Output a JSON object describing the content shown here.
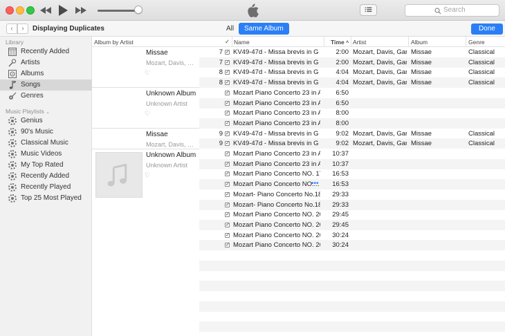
{
  "toolbar": {
    "search_placeholder": "Search",
    "volume_level": 0.92
  },
  "subbar": {
    "title": "Displaying Duplicates",
    "segment_all": "All",
    "segment_same_album": "Same Album",
    "done_label": "Done"
  },
  "sidebar": {
    "library_header": "Library",
    "library_items": [
      {
        "label": "Recently Added",
        "icon": "calendar-grid-icon"
      },
      {
        "label": "Artists",
        "icon": "microphone-icon"
      },
      {
        "label": "Albums",
        "icon": "album-icon"
      },
      {
        "label": "Songs",
        "icon": "music-note-icon",
        "selected": true
      },
      {
        "label": "Genres",
        "icon": "guitar-icon"
      }
    ],
    "playlists_header": "Music Playlists",
    "playlist_items": [
      {
        "label": "Genius"
      },
      {
        "label": "90's Music"
      },
      {
        "label": "Classical Music"
      },
      {
        "label": "Music Videos"
      },
      {
        "label": "My Top Rated"
      },
      {
        "label": "Recently Added"
      },
      {
        "label": "Recently Played"
      },
      {
        "label": "Top 25 Most Played"
      }
    ]
  },
  "columns": {
    "album_by_artist": "Album by Artist",
    "check": "✓",
    "name": "Name",
    "time": "Time",
    "artist": "Artist",
    "album": "Album",
    "genre": "Genre"
  },
  "albums": [
    {
      "name": "Missae",
      "artist": "Mozart, Davis, Gar..."
    },
    {
      "name": "Unknown Album",
      "artist": "Unknown Artist"
    },
    {
      "name": "Missae",
      "artist": "Mozart, Davis, Gar..."
    },
    {
      "name": "Unknown Album",
      "artist": "Unknown Artist"
    }
  ],
  "rows": [
    {
      "num": "7",
      "name": "KV49-47d - Missa brevis in G -",
      "time": "2:00",
      "artist": "Mozart, Davis, Gar...",
      "album": "Missae",
      "genre": "Classical"
    },
    {
      "num": "7",
      "name": "KV49-47d - Missa brevis in G -",
      "time": "2:00",
      "artist": "Mozart, Davis, Gar...",
      "album": "Missae",
      "genre": "Classical"
    },
    {
      "num": "8",
      "name": "KV49-47d - Missa brevis in G -",
      "time": "4:04",
      "artist": "Mozart, Davis, Gar...",
      "album": "Missae",
      "genre": "Classical"
    },
    {
      "num": "8",
      "name": "KV49-47d - Missa brevis in G -",
      "time": "4:04",
      "artist": "Mozart, Davis, Gar...",
      "album": "Missae",
      "genre": "Classical"
    },
    {
      "num": "",
      "name": "Mozart Piano Concerto 23 in A-...",
      "time": "6:50",
      "artist": "",
      "album": "",
      "genre": ""
    },
    {
      "num": "",
      "name": "Mozart Piano Concerto 23 in A-...",
      "time": "6:50",
      "artist": "",
      "album": "",
      "genre": ""
    },
    {
      "num": "",
      "name": "Mozart Piano Concerto 23 in A-...",
      "time": "8:00",
      "artist": "",
      "album": "",
      "genre": ""
    },
    {
      "num": "",
      "name": "Mozart Piano Concerto 23 in A-...",
      "time": "8:00",
      "artist": "",
      "album": "",
      "genre": ""
    },
    {
      "num": "9",
      "name": "KV49-47d - Missa brevis in G -",
      "time": "9:02",
      "artist": "Mozart, Davis, Gar...",
      "album": "Missae",
      "genre": "Classical"
    },
    {
      "num": "9",
      "name": "KV49-47d - Missa brevis in G -",
      "time": "9:02",
      "artist": "Mozart, Davis, Gar...",
      "album": "Missae",
      "genre": "Classical"
    },
    {
      "num": "",
      "name": "Mozart Piano Concerto 23 in A-...",
      "time": "10:37",
      "artist": "",
      "album": "",
      "genre": ""
    },
    {
      "num": "",
      "name": "Mozart Piano Concerto 23 in A-...",
      "time": "10:37",
      "artist": "",
      "album": "",
      "genre": ""
    },
    {
      "num": "",
      "name": "Mozart Piano Concerto NO. 17...",
      "time": "16:53",
      "artist": "",
      "album": "",
      "genre": ""
    },
    {
      "num": "",
      "name": "Mozart Piano Concerto NO....",
      "time": "16:53",
      "artist": "",
      "album": "",
      "genre": "",
      "more": "•••"
    },
    {
      "num": "",
      "name": "Mozart- Piano Concerto No.18...",
      "time": "29:33",
      "artist": "",
      "album": "",
      "genre": ""
    },
    {
      "num": "",
      "name": "Mozart- Piano Concerto No.18...",
      "time": "29:33",
      "artist": "",
      "album": "",
      "genre": ""
    },
    {
      "num": "",
      "name": "Mozart Piano Concerto NO. 20 i...",
      "time": "29:45",
      "artist": "",
      "album": "",
      "genre": ""
    },
    {
      "num": "",
      "name": "Mozart Piano Concerto NO. 20 i...",
      "time": "29:45",
      "artist": "",
      "album": "",
      "genre": ""
    },
    {
      "num": "",
      "name": "Mozart Piano Concerto NO. 26 i...",
      "time": "30:24",
      "artist": "",
      "album": "",
      "genre": ""
    },
    {
      "num": "",
      "name": "Mozart Piano Concerto NO. 26 i...",
      "time": "30:24",
      "artist": "",
      "album": "",
      "genre": ""
    }
  ],
  "colors": {
    "accent": "#2b7ff6",
    "sidebar_bg": "#f1f1f1",
    "selected_bg": "#d7d7d7"
  }
}
